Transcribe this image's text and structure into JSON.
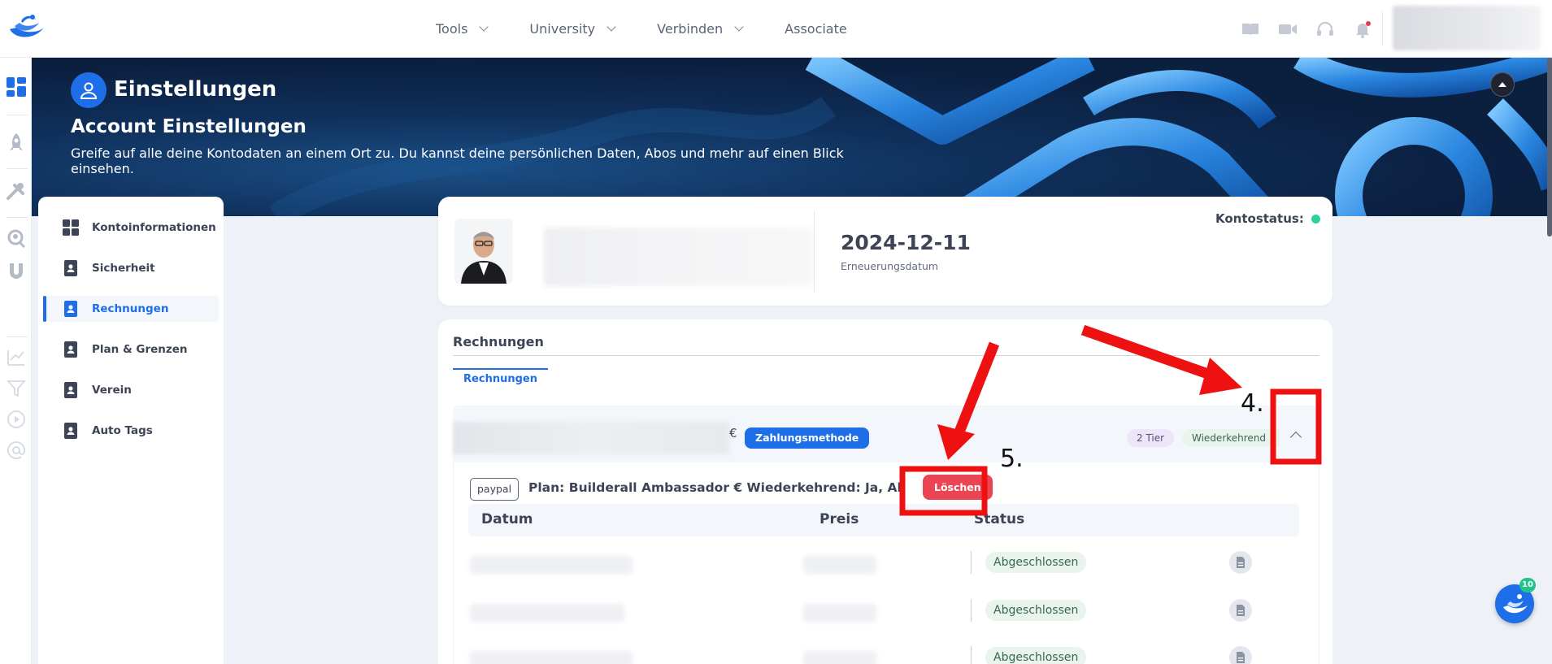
{
  "nav": {
    "items": [
      {
        "label": "Tools",
        "has_dropdown": true
      },
      {
        "label": "University",
        "has_dropdown": true
      },
      {
        "label": "Verbinden",
        "has_dropdown": true
      },
      {
        "label": "Associate",
        "has_dropdown": false
      }
    ]
  },
  "banner": {
    "title": "Einstellungen",
    "subtitle": "Account Einstellungen",
    "description": "Greife auf alle deine Kontodaten an einem Ort zu. Du kannst deine persönlichen Daten, Abos und mehr auf einen Blick einsehen."
  },
  "sidebar": {
    "items": [
      {
        "label": "Kontoinformationen",
        "icon": "grid-icon",
        "active": false
      },
      {
        "label": "Sicherheit",
        "icon": "contact-book-icon",
        "active": false
      },
      {
        "label": "Rechnungen",
        "icon": "contact-book-icon",
        "active": true
      },
      {
        "label": "Plan & Grenzen",
        "icon": "contact-book-icon",
        "active": false
      },
      {
        "label": "Verein",
        "icon": "contact-book-icon",
        "active": false
      },
      {
        "label": "Auto Tags",
        "icon": "contact-book-icon",
        "active": false
      }
    ]
  },
  "profile": {
    "renewal_date": "2024-12-11",
    "renewal_label": "Erneuerungsdatum",
    "status_label": "Kontostatus:",
    "status_color": "#2fd19a"
  },
  "invoices": {
    "header": "Rechnungen",
    "tab_label": "Rechnungen",
    "subscription": {
      "currency_symbol": "€",
      "payment_method_label": "Zahlungsmethode",
      "tier_label": "2 Tier",
      "recurring_label": "Wiederkehrend",
      "provider": "paypal",
      "plan_text": "Plan: Builderall Ambassador € Wiederkehrend: Ja, Aktiv",
      "delete_label": "Löschen"
    },
    "columns": {
      "date": "Datum",
      "price": "Preis",
      "status": "Status"
    },
    "rows": [
      {
        "status": "Abgeschlossen"
      },
      {
        "status": "Abgeschlossen"
      },
      {
        "status": "Abgeschlossen"
      }
    ]
  },
  "annotations": {
    "step4": "4.",
    "step5": "5.",
    "color": "#ee1111"
  },
  "chat": {
    "badge": "10"
  },
  "colors": {
    "accent": "#1e6ee8",
    "danger": "#eb4553",
    "success_bg": "#e8f4ec"
  }
}
